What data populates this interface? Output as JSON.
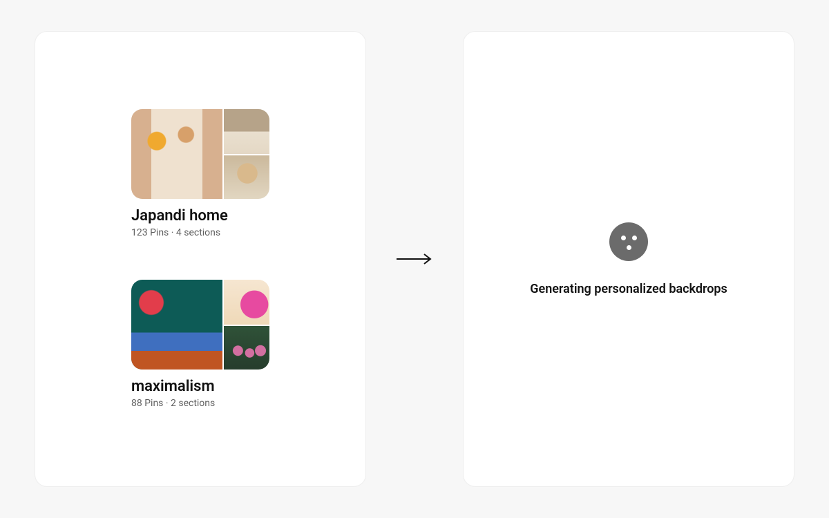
{
  "left_panel": {
    "boards": [
      {
        "title": "Japandi home",
        "meta": "123 Pins · 4 sections"
      },
      {
        "title": "maximalism",
        "meta": "88 Pins · 2 sections"
      }
    ]
  },
  "right_panel": {
    "status_text": "Generating personalized backdrops"
  }
}
